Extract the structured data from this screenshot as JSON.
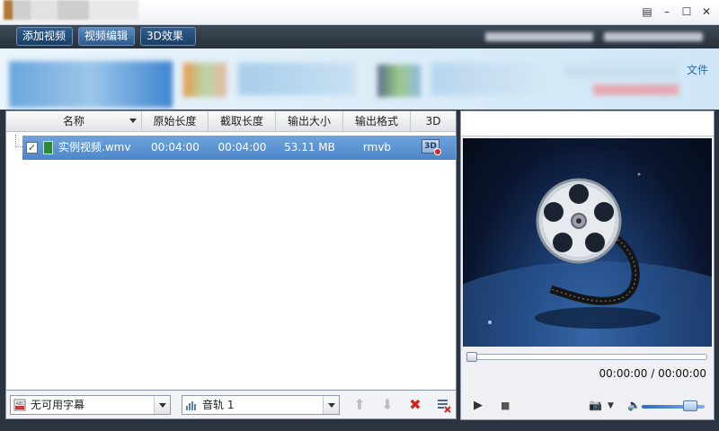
{
  "window": {
    "controls": [
      "menu",
      "minimize",
      "maximize",
      "close"
    ]
  },
  "toolbar": {
    "buttons": [
      {
        "label": "添加视频",
        "active": false
      },
      {
        "label": "视频编辑",
        "active": true
      },
      {
        "label": "3D效果",
        "active": false
      }
    ]
  },
  "banner": {
    "link_text": "文件"
  },
  "file_list": {
    "columns": [
      "名称",
      "原始长度",
      "截取长度",
      "输出大小",
      "输出格式",
      "3D"
    ],
    "rows": [
      {
        "checked": true,
        "name": "实例视频.wmv",
        "original_length": "00:04:00",
        "clip_length": "00:04:00",
        "output_size": "53.11 MB",
        "output_format": "rmvb",
        "badge": "3D"
      }
    ]
  },
  "bottom": {
    "subtitle_select": "无可用字幕",
    "audio_select": "音轨 1"
  },
  "preview": {
    "timecode": "00:00:00 / 00:00:00",
    "volume": 0.85
  },
  "colors": {
    "row_selected": "#4d86c9",
    "toolbar_bg": "#28313c",
    "delete_red": "#d22222"
  }
}
